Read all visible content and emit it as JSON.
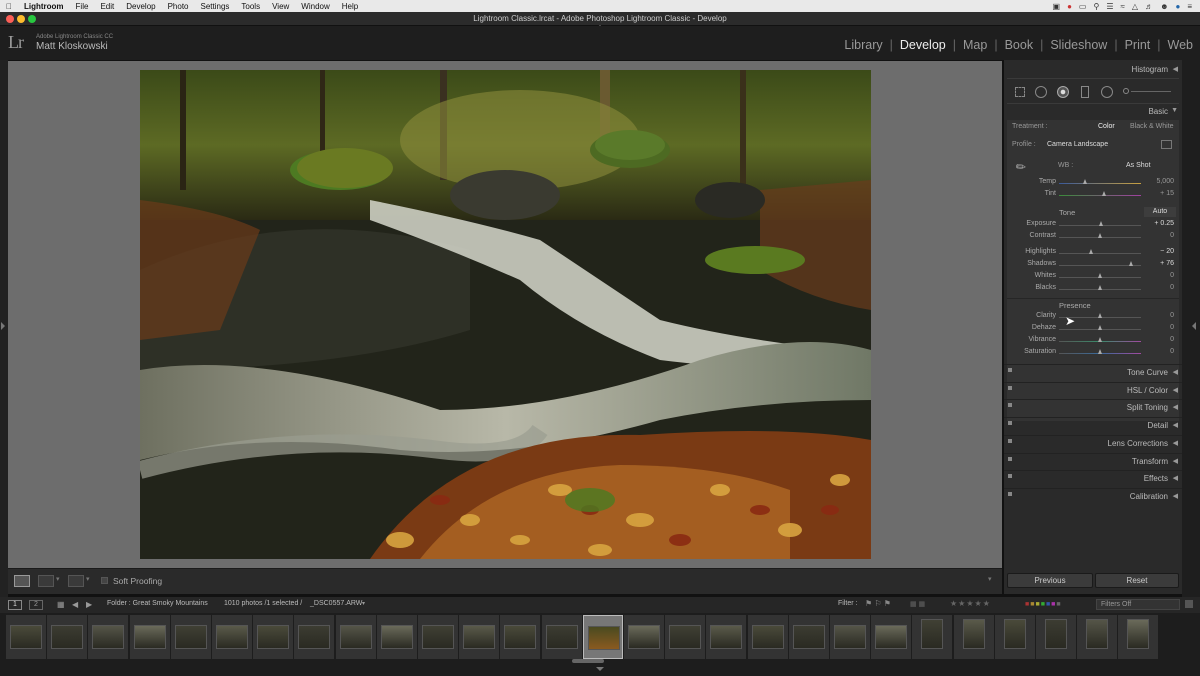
{
  "menubar": {
    "items": [
      "Lightroom",
      "File",
      "Edit",
      "Develop",
      "Photo",
      "Settings",
      "Tools",
      "View",
      "Window",
      "Help"
    ],
    "right_icons": [
      "camera-icon",
      "record-icon",
      "display-icon",
      "search-icon",
      "list-icon",
      "wifi-icon",
      "airplay-icon",
      "volume-icon",
      "user-icon",
      "spotlight-icon",
      "menu-icon"
    ]
  },
  "titlebar": {
    "title": "Lightroom Classic.lrcat - Adobe Photoshop Lightroom Classic - Develop"
  },
  "header": {
    "app_name": "Adobe Lightroom Classic CC",
    "user_name": "Matt Kloskowski",
    "logo": "Lr",
    "modules": [
      "Library",
      "Develop",
      "Map",
      "Book",
      "Slideshow",
      "Print",
      "Web"
    ],
    "active_module": "Develop"
  },
  "right_panel": {
    "histogram_label": "Histogram",
    "basic_label": "Basic",
    "treatment_label": "Treatment :",
    "treatment_color": "Color",
    "treatment_bw": "Black & White",
    "profile_label": "Profile :",
    "profile_value": "Camera Landscape",
    "wb_label": "WB :",
    "wb_value": "As Shot",
    "wb_sliders": [
      {
        "label": "Temp",
        "value": "5,000",
        "pos": 0.32
      },
      {
        "label": "Tint",
        "value": "+ 15",
        "pos": 0.55
      }
    ],
    "tone_label": "Tone",
    "auto_label": "Auto",
    "tone_sliders": [
      {
        "label": "Exposure",
        "value": "+ 0.25",
        "pos": 0.52,
        "bright": true
      },
      {
        "label": "Contrast",
        "value": "0",
        "pos": 0.5
      },
      {
        "label": "Highlights",
        "value": "− 20",
        "pos": 0.4,
        "bright": true
      },
      {
        "label": "Shadows",
        "value": "+ 76",
        "pos": 0.88,
        "bright": true
      },
      {
        "label": "Whites",
        "value": "0",
        "pos": 0.5
      },
      {
        "label": "Blacks",
        "value": "0",
        "pos": 0.5
      }
    ],
    "presence_label": "Presence",
    "presence_sliders": [
      {
        "label": "Clarity",
        "value": "0",
        "pos": 0.5
      },
      {
        "label": "Dehaze",
        "value": "0",
        "pos": 0.5
      },
      {
        "label": "Vibrance",
        "value": "0",
        "pos": 0.5
      },
      {
        "label": "Saturation",
        "value": "0",
        "pos": 0.5
      }
    ],
    "collapsed_sections": [
      "Tone Curve",
      "HSL / Color",
      "Split Toning",
      "Detail",
      "Lens Corrections",
      "Transform",
      "Effects",
      "Calibration"
    ],
    "previous_label": "Previous",
    "reset_label": "Reset"
  },
  "toolbar": {
    "soft_proofing": "Soft Proofing"
  },
  "filmbar": {
    "page1": "1",
    "page2": "2",
    "folder": "Folder : Great Smoky Mountains",
    "count": "1010 photos /1 selected /",
    "filename": "_DSC0557.ARW",
    "filter_label": "Filter :",
    "filters_off": "Filters Off"
  },
  "filmstrip": {
    "thumb_count": 28,
    "selected_index": 14
  },
  "colors": {
    "accent_active": "#eeeeee",
    "panel_bg": "#2a2a2a",
    "viewer_bg": "#6d6d6d"
  }
}
